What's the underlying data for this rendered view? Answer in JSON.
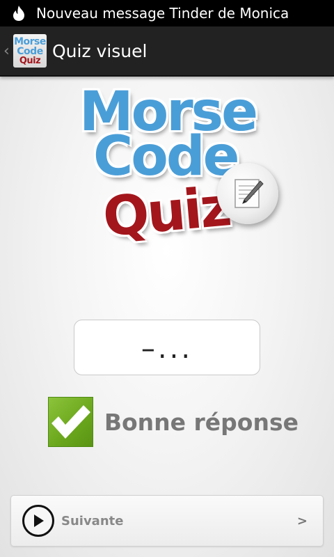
{
  "status_bar": {
    "notification_icon": "tinder-flame-icon",
    "notification_text": "Nouveau message Tinder de Monica"
  },
  "action_bar": {
    "up_indicator": "‹",
    "app_icon": {
      "line1": "Morse",
      "line2": "Code",
      "line3": "Quiz"
    },
    "title": "Quiz visuel"
  },
  "logo": {
    "line1": "Morse",
    "line2": "Code",
    "line3": "Quiz",
    "badge_icon": "notepad-pencil-icon",
    "colors": {
      "blue": "#4a9ed8",
      "red": "#a3161c"
    }
  },
  "question": {
    "morse": "–..."
  },
  "result": {
    "icon": "checkmark-icon",
    "text": "Bonne réponse",
    "color": "#7ab52c"
  },
  "next_button": {
    "icon": "play-icon",
    "label": "Suivante",
    "chevron": ">"
  }
}
